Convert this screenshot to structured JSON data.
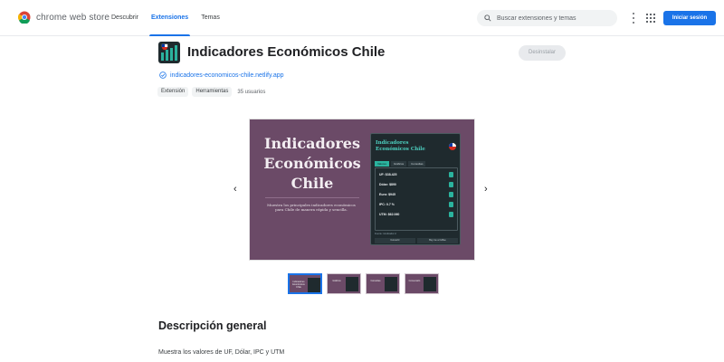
{
  "header": {
    "brand": "chrome web store",
    "nav": [
      "Descubrir",
      "Extensiones",
      "Temas"
    ],
    "active_nav": "Extensiones",
    "search_placeholder": "Buscar extensiones y temas",
    "signin_label": "Iniciar sesión",
    "accent_color": "#1a73e8"
  },
  "extension": {
    "title": "Indicadores Económicos Chile",
    "website": "indicadores-economicos-chile.netlify.app",
    "tags": [
      "Extensión",
      "Herramientas"
    ],
    "users": "35 usuarios",
    "uninstall_label": "Desinstalar",
    "icon": "bar-chart-chile-flag-icon"
  },
  "screenshot": {
    "title_lines": [
      "Indicadores",
      "Económicos",
      "Chile"
    ],
    "description": "Muestra los principales indicadores económicos para Chile de manera rápida y sencilla.",
    "popup_title": "Indicadores Económicos Chile",
    "tabs": [
      "Valores",
      "Gráficos",
      "Consultas"
    ],
    "rows": [
      "UF: $38.425",
      "Dólar: $890",
      "Euro: $945",
      "IPC: 0.7 %",
      "UTM: $62.060"
    ],
    "footer": "Fuente: mindicador.cl",
    "buttons": [
      "Convertir",
      "Buy me a Coffee"
    ],
    "background": "#6b4a67"
  },
  "thumbnails": [
    {
      "label": "Indicadores Económicos Chile"
    },
    {
      "label": "Gráficos"
    },
    {
      "label": "Consultas"
    },
    {
      "label": "Conversión"
    }
  ],
  "description": {
    "heading": "Descripción general",
    "text": "Muestra los valores de UF, Dólar, IPC y UTM"
  }
}
